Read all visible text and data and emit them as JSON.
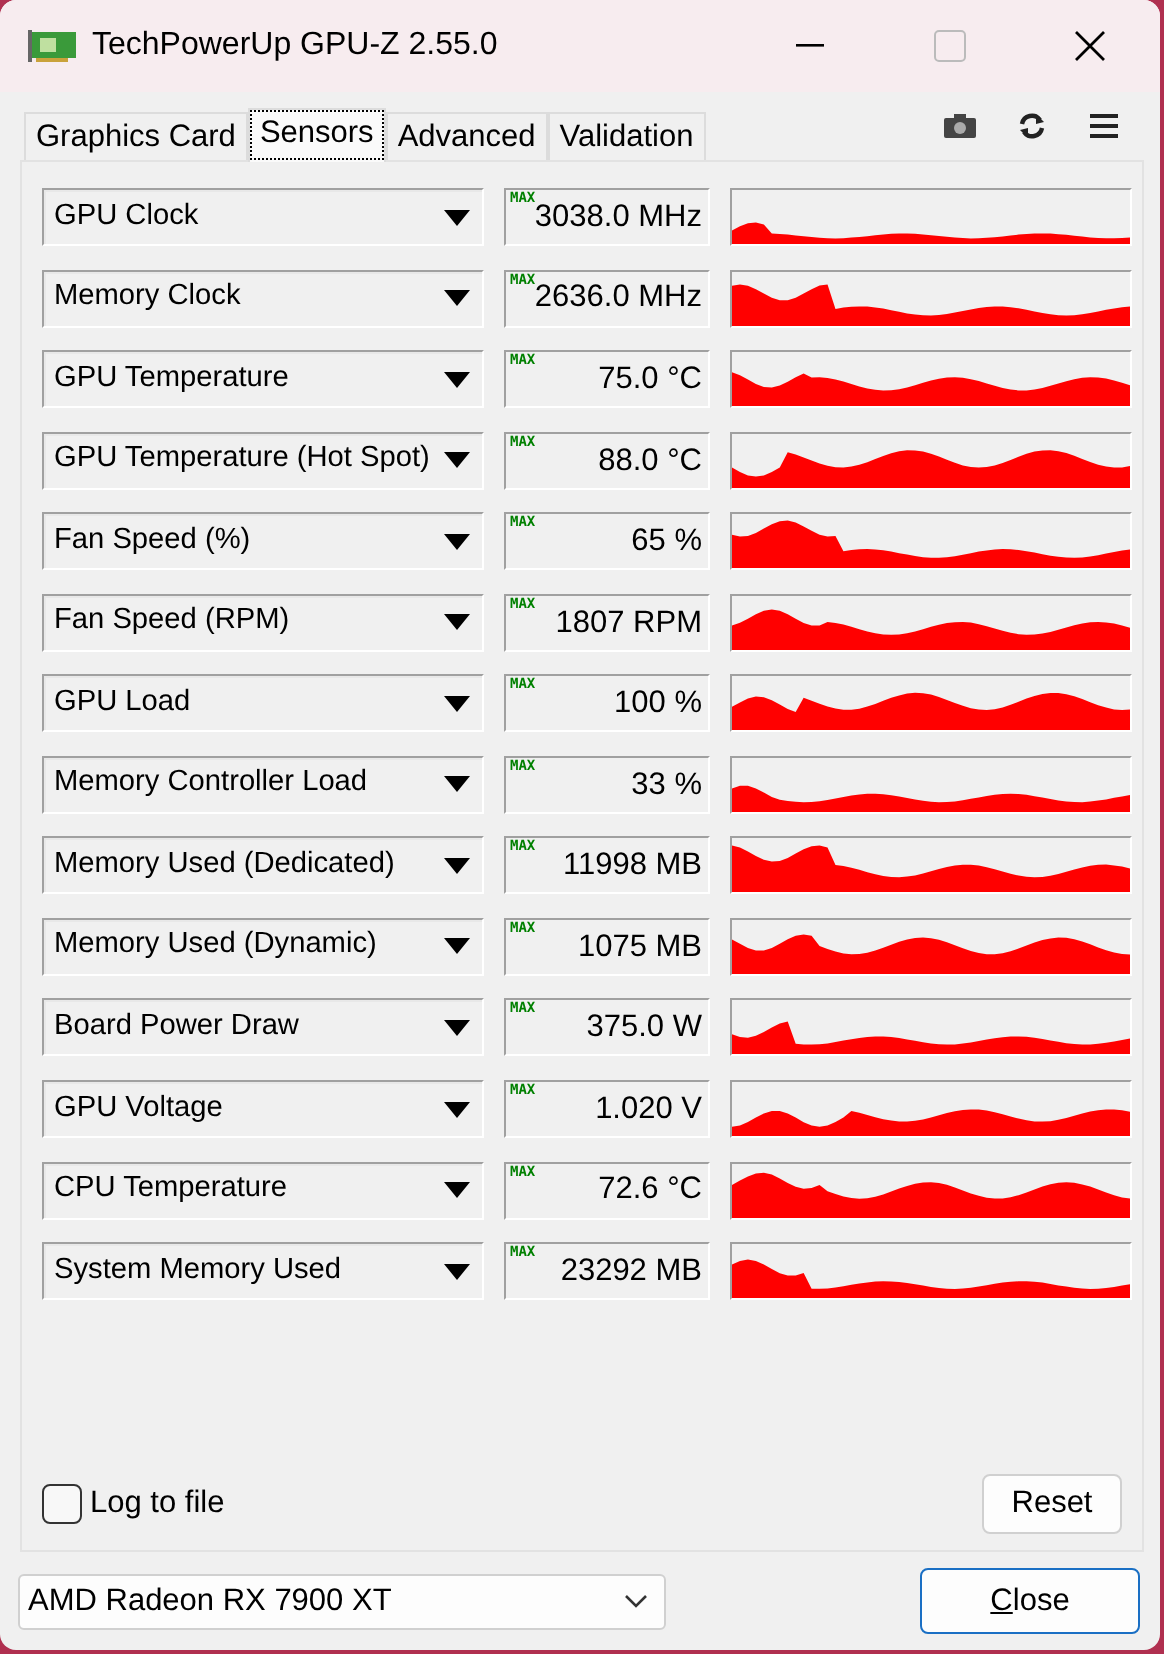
{
  "window": {
    "title": "TechPowerUp GPU-Z 2.55.0"
  },
  "tabs": [
    {
      "label": "Graphics Card",
      "selected": false
    },
    {
      "label": "Sensors",
      "selected": true
    },
    {
      "label": "Advanced",
      "selected": false
    },
    {
      "label": "Validation",
      "selected": false
    }
  ],
  "sensors": [
    {
      "name": "GPU Clock",
      "max_label": "MAX",
      "value": "3038.0 MHz"
    },
    {
      "name": "Memory Clock",
      "max_label": "MAX",
      "value": "2636.0 MHz"
    },
    {
      "name": "GPU Temperature",
      "max_label": "MAX",
      "value": "75.0 °C"
    },
    {
      "name": "GPU Temperature (Hot Spot)",
      "max_label": "MAX",
      "value": "88.0 °C"
    },
    {
      "name": "Fan Speed (%)",
      "max_label": "MAX",
      "value": "65 %"
    },
    {
      "name": "Fan Speed (RPM)",
      "max_label": "MAX",
      "value": "1807 RPM"
    },
    {
      "name": "GPU Load",
      "max_label": "MAX",
      "value": "100 %"
    },
    {
      "name": "Memory Controller Load",
      "max_label": "MAX",
      "value": "33 %"
    },
    {
      "name": "Memory Used (Dedicated)",
      "max_label": "MAX",
      "value": "11998 MB"
    },
    {
      "name": "Memory Used (Dynamic)",
      "max_label": "MAX",
      "value": "1075 MB"
    },
    {
      "name": "Board Power Draw",
      "max_label": "MAX",
      "value": "375.0 W"
    },
    {
      "name": "GPU Voltage",
      "max_label": "MAX",
      "value": "1.020 V"
    },
    {
      "name": "CPU Temperature",
      "max_label": "MAX",
      "value": "72.6 °C"
    },
    {
      "name": "System Memory Used",
      "max_label": "MAX",
      "value": "23292 MB"
    }
  ],
  "log_to_file": {
    "label": "Log to file",
    "checked": false
  },
  "reset_button": "Reset",
  "device_select": {
    "value": "AMD Radeon RX 7900 XT"
  },
  "close_button": "Close"
}
